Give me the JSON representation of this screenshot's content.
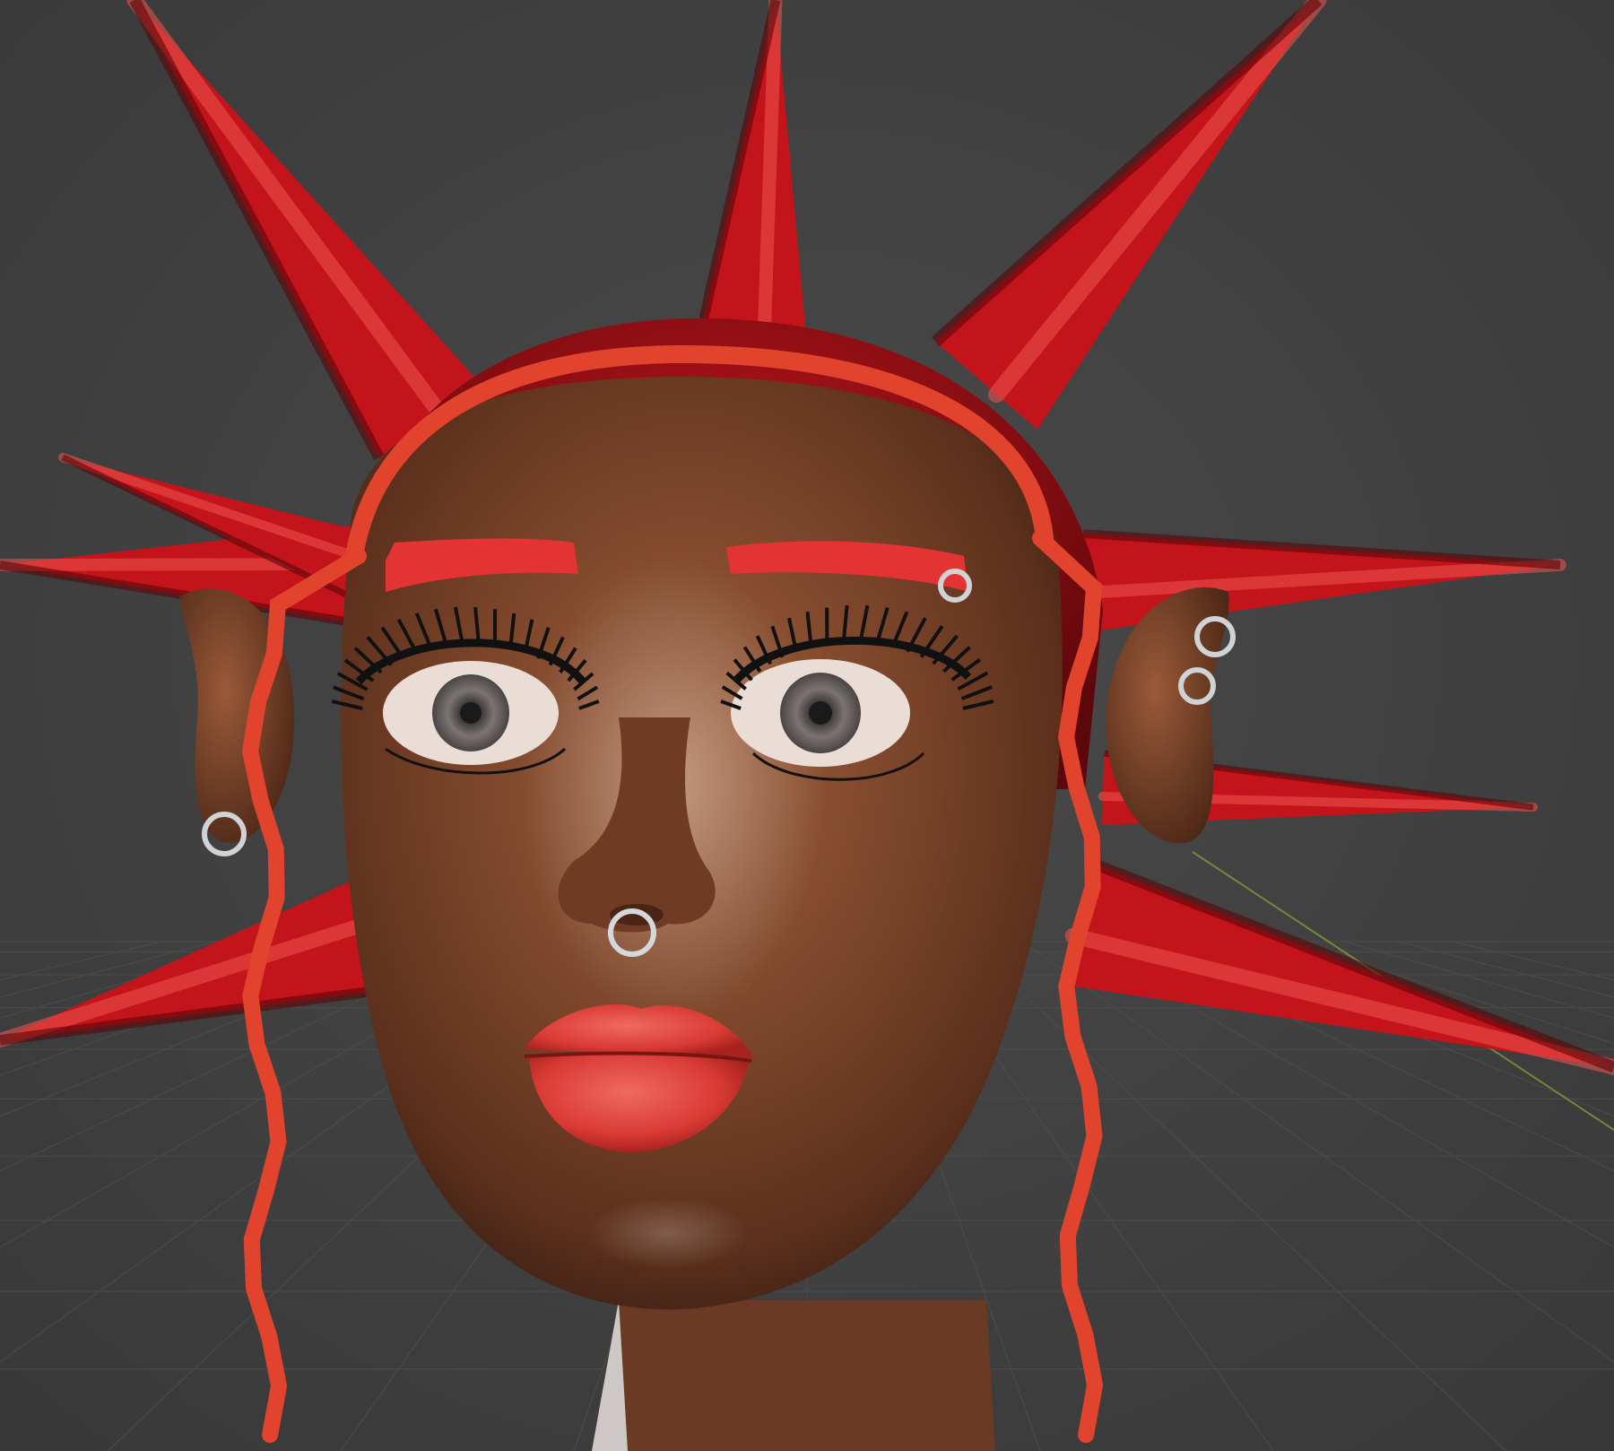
{
  "viewport": {
    "mode": "3d-viewport",
    "shading": "rendered",
    "background_color": "#404040",
    "grid_floor": true,
    "axis_line_color": "#7f9a3a"
  },
  "scene": {
    "object": "stylized-character-head",
    "palette": {
      "skin_base": "#6a3a24",
      "skin_light": "#9a5a38",
      "skin_shadow": "#3d1f13",
      "spike_red": "#c4141b",
      "spike_dark": "#5a0609",
      "spike_highlight": "#f0554f",
      "hair_strand": "#e2432d",
      "lip_red": "#e2423c",
      "brow_red": "#e43333",
      "iris_gray": "#6d6968",
      "sclera": "#eadfd8",
      "silver": "#cfd3d6"
    },
    "features": {
      "spike_count": 9,
      "piercings": [
        "septum-ring",
        "brow-ring",
        "ear-hoop-left",
        "ear-hoops-right"
      ]
    }
  }
}
